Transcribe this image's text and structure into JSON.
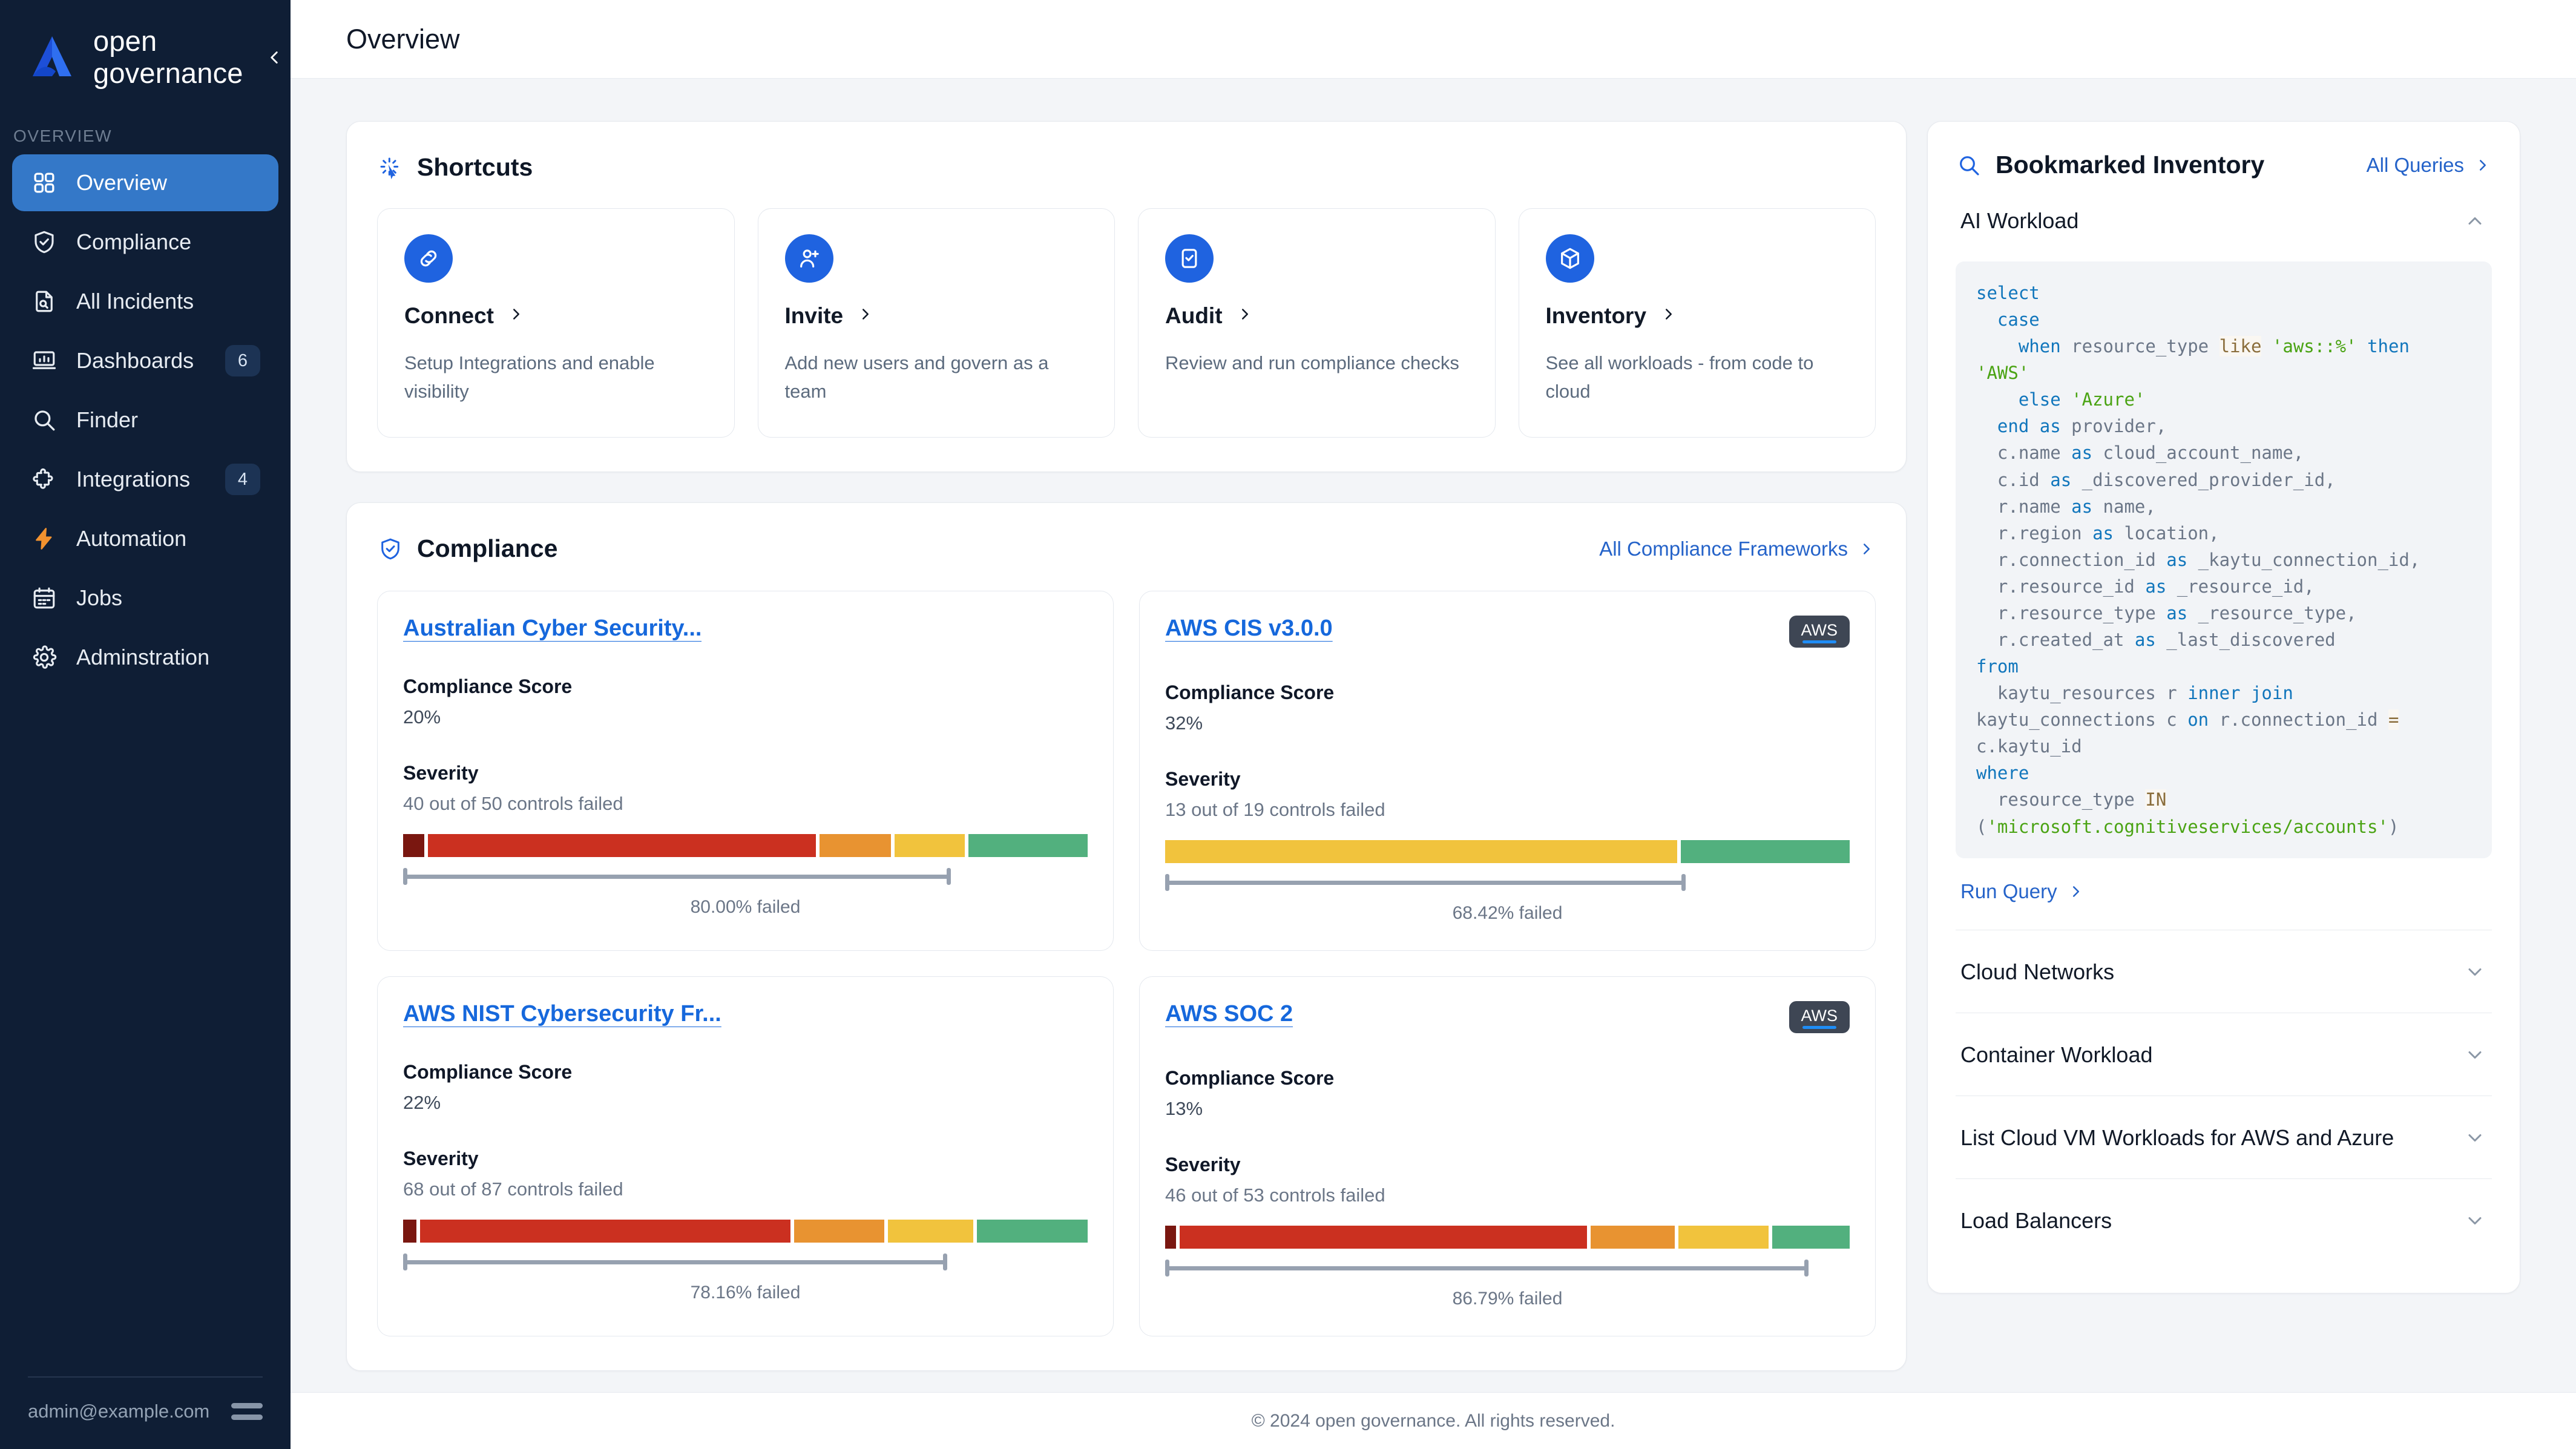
{
  "sidebar": {
    "brand_name": "open governance",
    "collapse_icon": "chevron-left-icon",
    "section_label": "OVERVIEW",
    "items": [
      {
        "label": "Overview",
        "icon": "grid-icon",
        "badge": "",
        "active": true
      },
      {
        "label": "Compliance",
        "icon": "shield-check-icon",
        "badge": "",
        "active": false
      },
      {
        "label": "All Incidents",
        "icon": "document-search-icon",
        "badge": "",
        "active": false
      },
      {
        "label": "Dashboards",
        "icon": "chart-board-icon",
        "badge": "6",
        "active": false
      },
      {
        "label": "Finder",
        "icon": "magnifier-icon",
        "badge": "",
        "active": false
      },
      {
        "label": "Integrations",
        "icon": "puzzle-icon",
        "badge": "4",
        "active": false
      },
      {
        "label": "Automation",
        "icon": "bolt-icon",
        "badge": "",
        "active": false
      },
      {
        "label": "Jobs",
        "icon": "calendar-icon",
        "badge": "",
        "active": false
      },
      {
        "label": "Adminstration",
        "icon": "gear-icon",
        "badge": "",
        "active": false
      }
    ],
    "user_email": "admin@example.com",
    "menu_icon": "hamburger-icon"
  },
  "header": {
    "title": "Overview"
  },
  "shortcuts": {
    "title": "Shortcuts",
    "icon": "cursor-click-icon",
    "cards": [
      {
        "name": "Connect",
        "icon": "link-icon",
        "desc": "Setup Integrations and enable visibility"
      },
      {
        "name": "Invite",
        "icon": "user-plus-icon",
        "desc": "Add new users and govern as a team"
      },
      {
        "name": "Audit",
        "icon": "clipboard-check-icon",
        "desc": "Review and run compliance checks"
      },
      {
        "name": "Inventory",
        "icon": "cube-icon",
        "desc": "See all workloads - from code to cloud"
      }
    ]
  },
  "compliance": {
    "title": "Compliance",
    "icon": "shield-check-icon",
    "all_link": "All Compliance Frameworks",
    "score_label": "Compliance Score",
    "severity_label": "Severity",
    "frameworks": [
      {
        "name": "Australian Cyber Security...",
        "badge": "",
        "score": "20%",
        "controls": "40 out of 50 controls failed",
        "failed_caption": "80.00% failed",
        "failed_pct": 80.0,
        "segments": [
          {
            "name": "critical",
            "color": "#7a1710",
            "pct": 3.2
          },
          {
            "name": "high",
            "color": "#cb3020",
            "pct": 57.9
          },
          {
            "name": "medium",
            "color": "#e89331",
            "pct": 10.6
          },
          {
            "name": "low",
            "color": "#f1c33d",
            "pct": 10.5
          },
          {
            "name": "passed",
            "color": "#52b07e",
            "pct": 17.8
          }
        ]
      },
      {
        "name": "AWS CIS v3.0.0",
        "badge": "AWS",
        "score": "32%",
        "controls": "13 out of 19 controls failed",
        "failed_caption": "68.42% failed",
        "failed_pct": 76.0,
        "segments": [
          {
            "name": "low",
            "color": "#f1c33d",
            "pct": 75.2
          },
          {
            "name": "passed",
            "color": "#52b07e",
            "pct": 24.8
          }
        ]
      },
      {
        "name": "AWS NIST Cybersecurity Fr...",
        "badge": "",
        "score": "22%",
        "controls": "68 out of 87 controls failed",
        "failed_caption": "78.16% failed",
        "failed_pct": 79.5,
        "segments": [
          {
            "name": "critical",
            "color": "#7a1710",
            "pct": 2.0
          },
          {
            "name": "high",
            "color": "#cb3020",
            "pct": 55.3
          },
          {
            "name": "medium",
            "color": "#e89331",
            "pct": 13.4
          },
          {
            "name": "low",
            "color": "#f1c33d",
            "pct": 12.8
          },
          {
            "name": "passed",
            "color": "#52b07e",
            "pct": 16.5
          }
        ]
      },
      {
        "name": "AWS SOC 2",
        "badge": "AWS",
        "score": "13%",
        "controls": "46 out of 53 controls failed",
        "failed_caption": "86.79% failed",
        "failed_pct": 94.0,
        "segments": [
          {
            "name": "critical",
            "color": "#7a1710",
            "pct": 1.6
          },
          {
            "name": "high",
            "color": "#cb3020",
            "pct": 60.8
          },
          {
            "name": "medium",
            "color": "#e89331",
            "pct": 12.6
          },
          {
            "name": "low",
            "color": "#f1c33d",
            "pct": 13.4
          },
          {
            "name": "passed",
            "color": "#52b07e",
            "pct": 11.6
          }
        ]
      }
    ]
  },
  "bookmarked": {
    "title": "Bookmarked Inventory",
    "icon": "magnifier-icon",
    "all_link": "All Queries",
    "run_query_label": "Run Query",
    "items": [
      {
        "name": "AI Workload",
        "expanded": true,
        "chevron": "chevron-up-icon"
      },
      {
        "name": "Cloud Networks",
        "expanded": false,
        "chevron": "chevron-down-icon"
      },
      {
        "name": "Container Workload",
        "expanded": false,
        "chevron": "chevron-down-icon"
      },
      {
        "name": "List Cloud VM Workloads for AWS and Azure",
        "expanded": false,
        "chevron": "chevron-down-icon"
      },
      {
        "name": "Load Balancers",
        "expanded": false,
        "chevron": "chevron-down-icon"
      }
    ],
    "query_tokens": [
      {
        "t": "select\n  ",
        "c": "kw"
      },
      {
        "t": "case\n    ",
        "c": "kw"
      },
      {
        "t": "when ",
        "c": "kw"
      },
      {
        "t": "resource_type ",
        "c": "id"
      },
      {
        "t": "like",
        "c": "op"
      },
      {
        "t": " ",
        "c": "id"
      },
      {
        "t": "'aws::%'",
        "c": "str"
      },
      {
        "t": " ",
        "c": "id"
      },
      {
        "t": "then",
        "c": "kw"
      },
      {
        "t": " ",
        "c": "id"
      },
      {
        "t": "'AWS'",
        "c": "str"
      },
      {
        "t": "\n    ",
        "c": "id"
      },
      {
        "t": "else",
        "c": "kw"
      },
      {
        "t": " ",
        "c": "id"
      },
      {
        "t": "'Azure'",
        "c": "str"
      },
      {
        "t": "\n  ",
        "c": "id"
      },
      {
        "t": "end",
        "c": "kw"
      },
      {
        "t": " ",
        "c": "id"
      },
      {
        "t": "as",
        "c": "kw"
      },
      {
        "t": " provider,\n  c.name ",
        "c": "id"
      },
      {
        "t": "as",
        "c": "kw"
      },
      {
        "t": " cloud_account_name,\n  c.id ",
        "c": "id"
      },
      {
        "t": "as",
        "c": "kw"
      },
      {
        "t": " _discovered_provider_id,\n  r.name ",
        "c": "id"
      },
      {
        "t": "as",
        "c": "kw"
      },
      {
        "t": " name,\n  r.region ",
        "c": "id"
      },
      {
        "t": "as",
        "c": "kw"
      },
      {
        "t": " location,\n  r.connection_id ",
        "c": "id"
      },
      {
        "t": "as",
        "c": "kw"
      },
      {
        "t": " _kaytu_connection_id,\n  r.resource_id ",
        "c": "id"
      },
      {
        "t": "as",
        "c": "kw"
      },
      {
        "t": " _resource_id,\n  r.resource_type ",
        "c": "id"
      },
      {
        "t": "as",
        "c": "kw"
      },
      {
        "t": " _resource_type,\n  r.created_at ",
        "c": "id"
      },
      {
        "t": "as",
        "c": "kw"
      },
      {
        "t": " _last_discovered\n",
        "c": "id"
      },
      {
        "t": "from",
        "c": "kw"
      },
      {
        "t": "\n  kaytu_resources r ",
        "c": "id"
      },
      {
        "t": "inner join",
        "c": "kw"
      },
      {
        "t": "\nkaytu_connections c ",
        "c": "id"
      },
      {
        "t": "on",
        "c": "kw"
      },
      {
        "t": " r.connection_id ",
        "c": "id"
      },
      {
        "t": "=",
        "c": "op"
      },
      {
        "t": "\nc.kaytu_id\n",
        "c": "id"
      },
      {
        "t": "where",
        "c": "kw"
      },
      {
        "t": "\n  resource_type ",
        "c": "id"
      },
      {
        "t": "IN",
        "c": "op"
      },
      {
        "t": "\n(",
        "c": "id"
      },
      {
        "t": "'microsoft.cognitiveservices/accounts'",
        "c": "str"
      },
      {
        "t": ")",
        "c": "id"
      }
    ]
  },
  "footer": {
    "text": "© 2024 open governance. All rights reserved."
  },
  "colors": {
    "sidebar_bg": "#0f1e35",
    "accent": "#1f63e0",
    "link": "#2563c9",
    "framework_link": "#1668dc",
    "active_nav": "#3478c8",
    "page_bg": "#f3f5f8"
  }
}
